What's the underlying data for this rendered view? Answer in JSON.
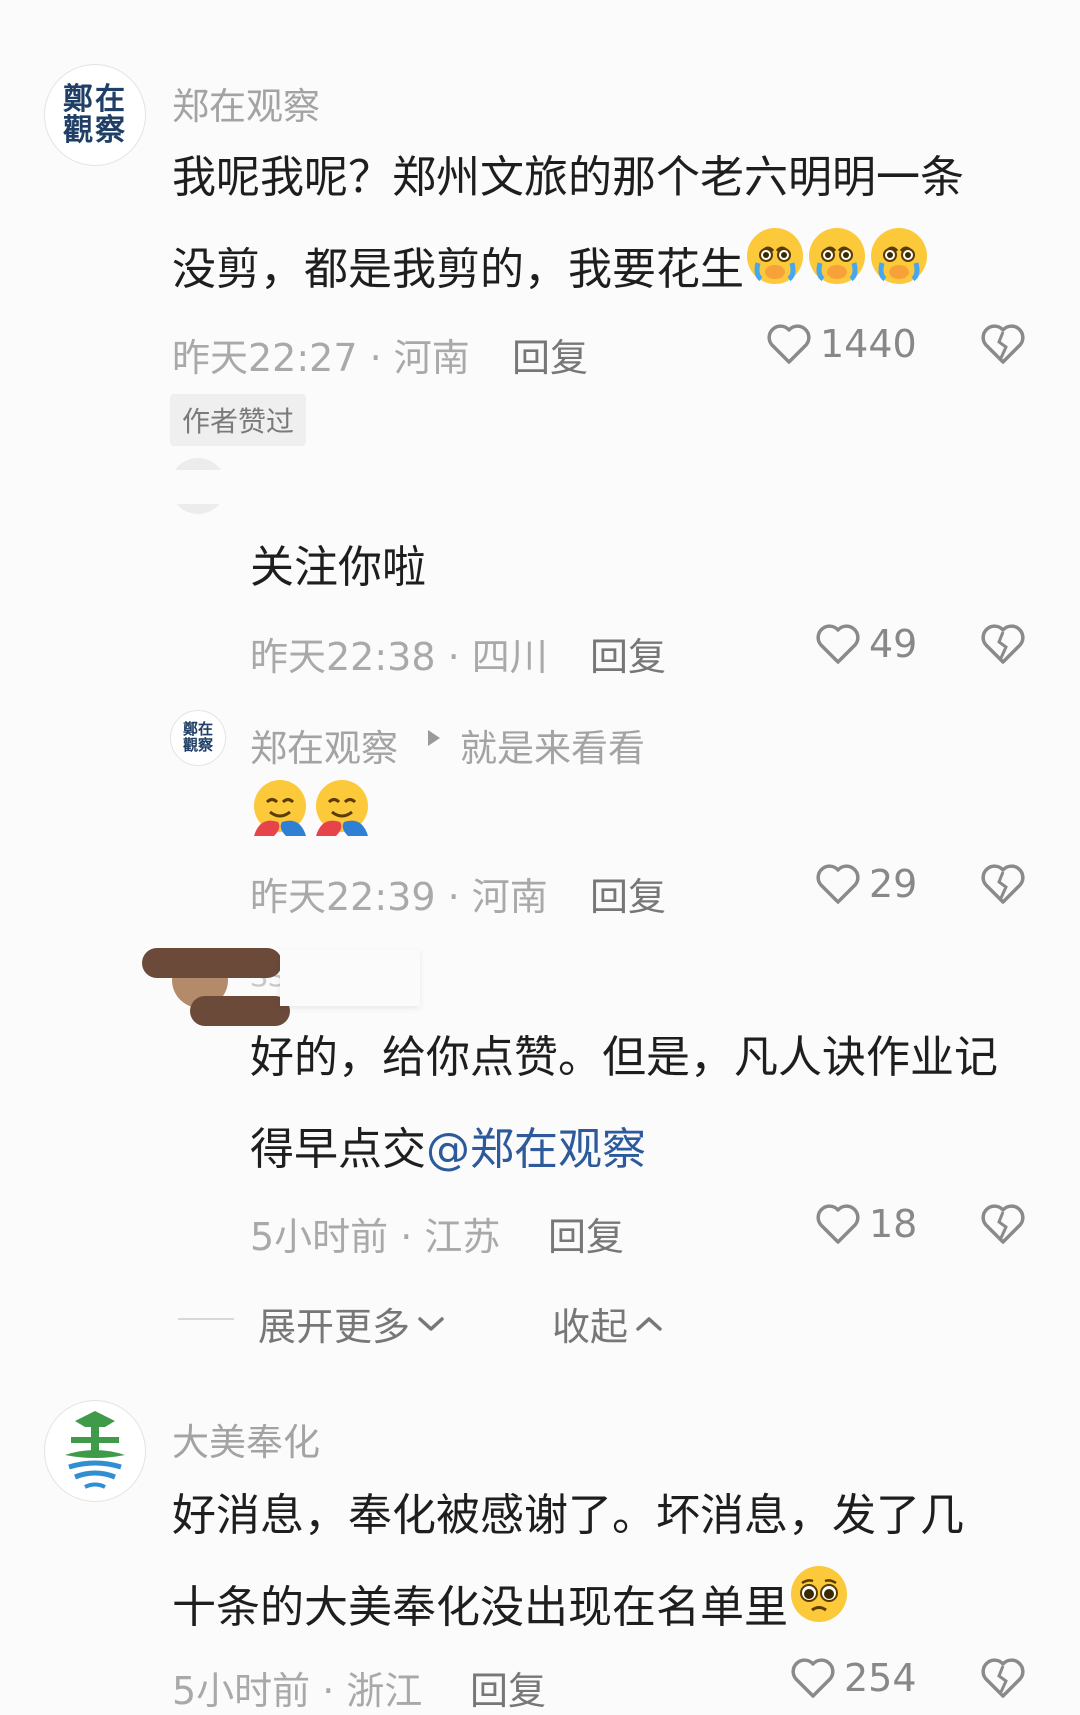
{
  "comments": [
    {
      "author": "郑在观察",
      "avatar_text": "鄭在觀察",
      "text_line1": "我呢我呢？郑州文旅的那个老六明明一条",
      "text_line2": "没剪，都是我剪的，我要花生",
      "emoji": [
        "crying-emoji",
        "crying-emoji",
        "crying-emoji"
      ],
      "time": "昨天22:27 · 河南",
      "reply_label": "回复",
      "likes": "1440",
      "badge": "作者赞过"
    },
    {
      "author": "大美奉化",
      "text_line1": "好消息，奉化被感谢了。坏消息，发了几",
      "text_line2": "十条的大美奉化没出现在名单里",
      "emoji": [
        "pleading-emoji"
      ],
      "time": "5小时前 · 浙江",
      "reply_label": "回复",
      "likes": "254"
    }
  ],
  "replies": [
    {
      "author": "就是来看看",
      "text": "关注你啦",
      "time": "昨天22:38 · 四川",
      "reply_label": "回复",
      "likes": "49"
    },
    {
      "author": "郑在观察",
      "avatar_text": "鄭在觀察",
      "reply_to": "就是来看看",
      "emoji": [
        "hug-emoji",
        "hug-emoji"
      ],
      "time": "昨天22:39 · 河南",
      "reply_label": "回复",
      "likes": "29"
    },
    {
      "author": "SSUN...",
      "text_line1": "好的，给你点赞。但是，凡人诀作业记",
      "text_line2_prefix": "得早点交",
      "mention": "@郑在观察",
      "time": "5小时前 · 江苏",
      "reply_label": "回复",
      "likes": "18"
    }
  ],
  "thread_controls": {
    "expand_label": "展开更多",
    "collapse_label": "收起"
  },
  "colors": {
    "mention": "#2c5a9a",
    "meta": "#a9a9a9",
    "background": "#fbfbfb"
  }
}
